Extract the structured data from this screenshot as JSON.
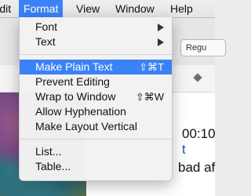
{
  "menubar": {
    "items": [
      "Edit",
      "Format",
      "View",
      "Window",
      "Help"
    ],
    "active": "Format"
  },
  "background": {
    "reg_box_text": "Regu",
    "doc_lines": [
      "00:10",
      "t",
      "bad af"
    ]
  },
  "format_menu": {
    "font": "Font",
    "text": "Text",
    "make_plain_text": "Make Plain Text",
    "make_plain_text_shortcut": "⇧⌘T",
    "prevent_editing": "Prevent Editing",
    "wrap_to_window": "Wrap to Window",
    "wrap_to_window_shortcut": "⇧⌘W",
    "allow_hyphenation": "Allow Hyphenation",
    "make_layout_vertical": "Make Layout Vertical",
    "list": "List...",
    "table": "Table..."
  },
  "colors": {
    "accent": "#3b82f6",
    "menu_bg": "#f2f2f2"
  }
}
